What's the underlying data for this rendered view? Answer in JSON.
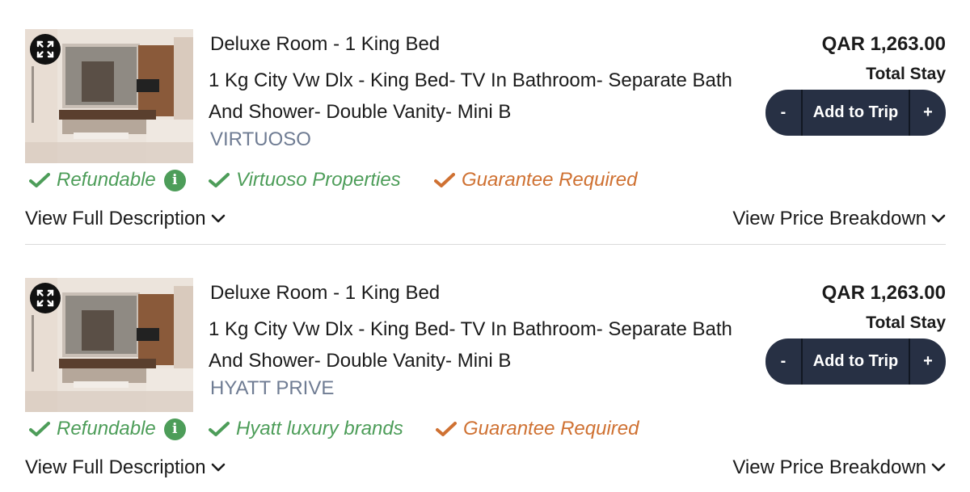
{
  "rates": [
    {
      "image_alt": "Bathroom with mirror, vanity and bathtub",
      "room_name": "Deluxe Room - 1 King Bed",
      "description": "1 Kg City Vw Dlx - King Bed- TV In Bathroom- Separate Bath And Shower- Double Vanity- Mini B",
      "program": "VIRTUOSO",
      "price": "QAR 1,263.00",
      "price_label": "Total Stay",
      "cart": {
        "minus": "-",
        "add": "Add to Trip",
        "plus": "+"
      },
      "badges": {
        "refundable": "Refundable",
        "program_badge": "Virtuoso Properties",
        "guarantee": "Guarantee Required"
      },
      "links": {
        "description": "View Full Description",
        "breakdown": "View Price Breakdown"
      }
    },
    {
      "image_alt": "Bathroom with mirror, vanity and bathtub",
      "room_name": "Deluxe Room - 1 King Bed",
      "description": "1 Kg City Vw Dlx - King Bed- TV In Bathroom- Separate Bath And Shower- Double Vanity- Mini B",
      "program": "HYATT PRIVE",
      "price": "QAR 1,263.00",
      "price_label": "Total Stay",
      "cart": {
        "minus": "-",
        "add": "Add to Trip",
        "plus": "+"
      },
      "badges": {
        "refundable": "Refundable",
        "program_badge": "Hyatt luxury brands",
        "guarantee": "Guarantee Required"
      },
      "links": {
        "description": "View Full Description",
        "breakdown": "View Price Breakdown"
      }
    }
  ],
  "icons": {
    "expand": "expand-icon",
    "check": "check-icon",
    "info": "info-icon",
    "chevron": "chevron-down-icon"
  },
  "colors": {
    "refundable_green": "#4d9d59",
    "guarantee_orange": "#cf7132",
    "program_gray": "#6f7c93",
    "button_navy": "#273044"
  }
}
